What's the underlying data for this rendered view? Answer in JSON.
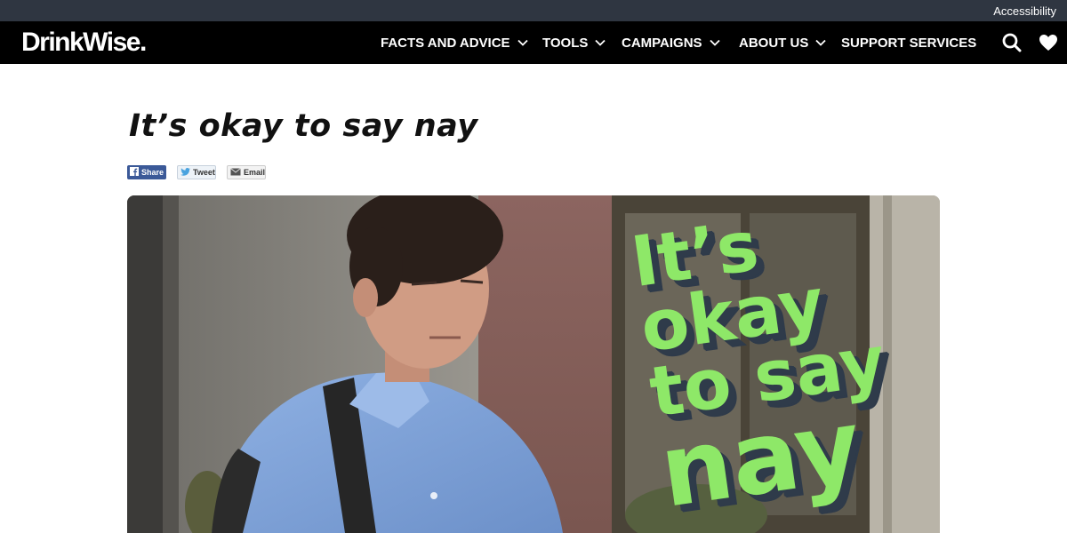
{
  "utility": {
    "accessibility_label": "Accessibility"
  },
  "brand": {
    "logo_text": "DrinkWise."
  },
  "nav": {
    "items": [
      {
        "label": "FACTS AND ADVICE",
        "has_dropdown": true
      },
      {
        "label": "TOOLS",
        "has_dropdown": true
      },
      {
        "label": "CAMPAIGNS",
        "has_dropdown": true
      },
      {
        "label": "ABOUT US",
        "has_dropdown": true
      },
      {
        "label": "SUPPORT SERVICES",
        "has_dropdown": false
      }
    ],
    "icons": [
      "search-icon",
      "heart-icon"
    ]
  },
  "page": {
    "title": "It’s okay to say nay"
  },
  "share": {
    "facebook_label": "Share",
    "twitter_label": "Tweet",
    "email_label": "Email"
  },
  "hero": {
    "text_lines": [
      "It’s",
      "okay",
      "to say",
      "nay"
    ],
    "text_color": "#8ee868",
    "shadow_color": "#2f3b4a"
  },
  "colors": {
    "utility_bar": "#2f3641",
    "nav_bar": "#000000",
    "facebook": "#3b5998"
  }
}
